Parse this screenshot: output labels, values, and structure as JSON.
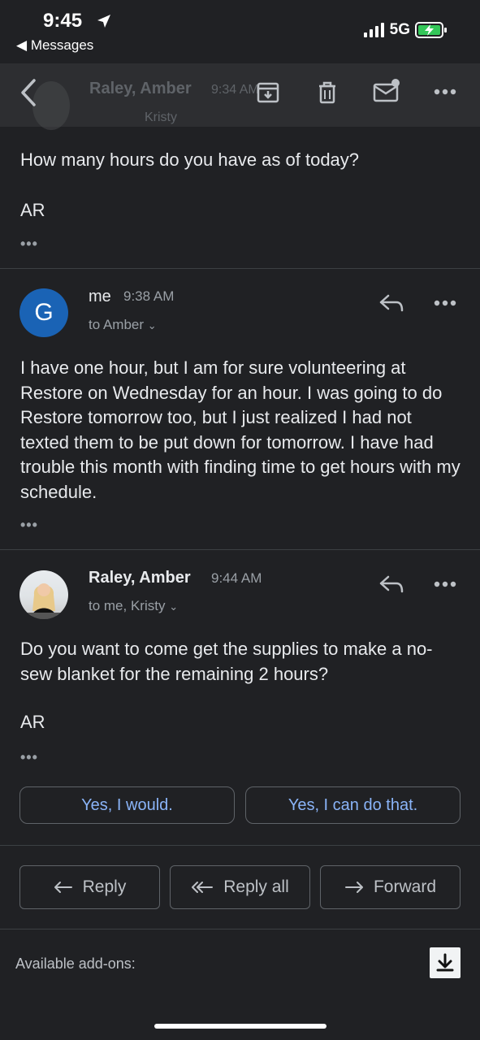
{
  "status": {
    "time": "9:45",
    "back_label": "Messages",
    "network": "5G"
  },
  "toolbar": {
    "ghost_sender": "Raley, Amber",
    "ghost_time": "9:34 AM",
    "ghost_recipients": "Kristy"
  },
  "messages": [
    {
      "body": "How many hours do you have as of today?",
      "signature": "AR"
    },
    {
      "sender": "me",
      "avatar_letter": "G",
      "time": "9:38 AM",
      "to": "to Amber",
      "body": "I have one hour, but I am for sure volunteering at Restore on Wednesday for an hour. I was going to do Restore tomorrow too, but I just realized I had not texted them to be put down for tomorrow. I have had trouble this month with finding time to get hours with my schedule."
    },
    {
      "sender": "Raley, Amber",
      "time": "9:44 AM",
      "to": "to me, Kristy",
      "body": "Do you want to come get the supplies to make a no-sew blanket for the remaining 2 hours?",
      "signature": "AR"
    }
  ],
  "smart_replies": [
    "Yes, I would.",
    "Yes, I can do that."
  ],
  "actions": {
    "reply": "Reply",
    "reply_all": "Reply all",
    "forward": "Forward"
  },
  "addons": {
    "label": "Available add-ons:"
  },
  "colors": {
    "background": "#202124",
    "accent_link": "#8ab4f8",
    "avatar_blue": "#1a63b5"
  }
}
